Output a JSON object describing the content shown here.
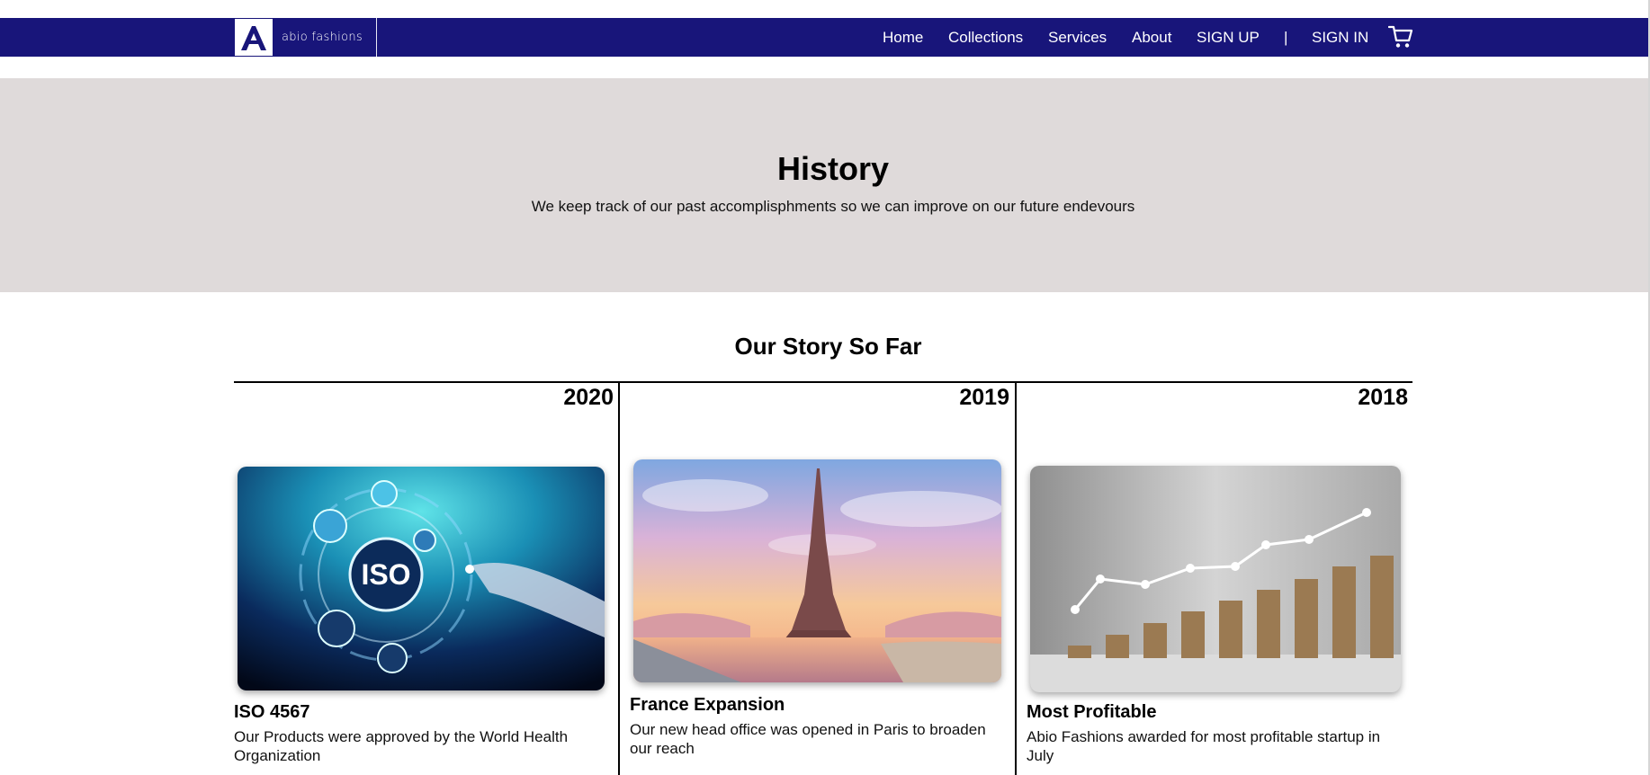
{
  "brand": {
    "logo_letter": "A",
    "name": "abio fashions"
  },
  "nav": {
    "home": "Home",
    "collections": "Collections",
    "services": "Services",
    "about": "About",
    "signup": "SIGN UP",
    "separator": "|",
    "signin": "SIGN IN",
    "cart_icon": "cart-icon"
  },
  "hero": {
    "title": "History",
    "subtitle": "We keep track of our past accomplisphments so we can improve on our future endevours"
  },
  "story": {
    "title": "Our Story So Far",
    "items": [
      {
        "year": "2020",
        "title": "ISO 4567",
        "text": "Our Products were approved by the World Health Organization",
        "image": "iso-certification-image"
      },
      {
        "year": "2019",
        "title": "France Expansion",
        "text": "Our new head office was opened in Paris to broaden our reach",
        "image": "eiffel-tower-image"
      },
      {
        "year": "2018",
        "title": "Most Profitable",
        "text": "Abio Fashions awarded for most profitable startup in July",
        "image": "coin-stacks-growth-image"
      }
    ]
  },
  "colors": {
    "navbar": "#18157a",
    "hero_bg": "#dfdada"
  }
}
